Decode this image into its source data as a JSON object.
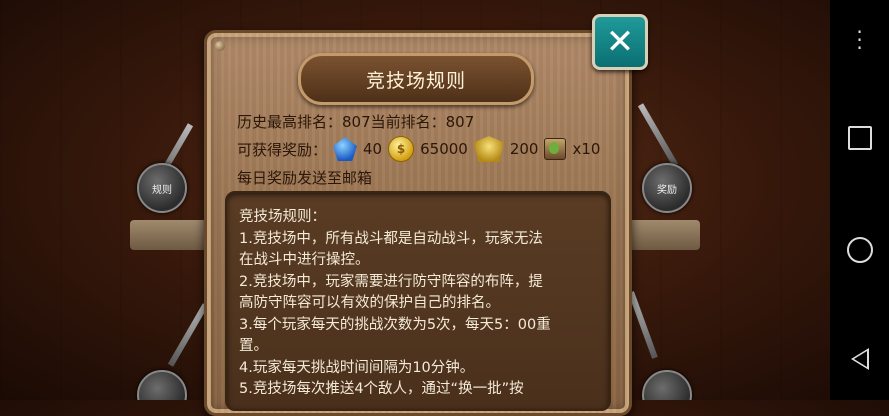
{
  "dialog": {
    "title": "竞技场规则",
    "close_label": "✕",
    "rank_line": "历史最高排名：807当前排名：807",
    "reward_label": "可获得奖励：",
    "rewards": [
      {
        "icon": "diamond-icon",
        "amount": "40"
      },
      {
        "icon": "gold-coin-icon",
        "amount": "65000"
      },
      {
        "icon": "honor-badge-icon",
        "amount": "200"
      },
      {
        "icon": "potion-icon",
        "amount": "x10"
      }
    ],
    "mail_line": "每日奖励发送至邮箱",
    "rules_heading": "竞技场规则：",
    "rules": [
      "1.竞技场中，所有战斗都是自动战斗，玩家无法",
      "在战斗中进行操控。",
      "2.竞技场中，玩家需要进行防守阵容的布阵，提",
      "高防守阵容可以有效的保护自己的排名。",
      "3.每个玩家每天的挑战次数为5次，每天5：00重",
      "置。",
      "4.玩家每天挑战时间间隔为10分钟。",
      "5.竞技场每次推送4个敌人，通过“换一批”按"
    ]
  },
  "background": {
    "left_button": "规则",
    "right_button": "奖励"
  },
  "coin_glyph": "$"
}
